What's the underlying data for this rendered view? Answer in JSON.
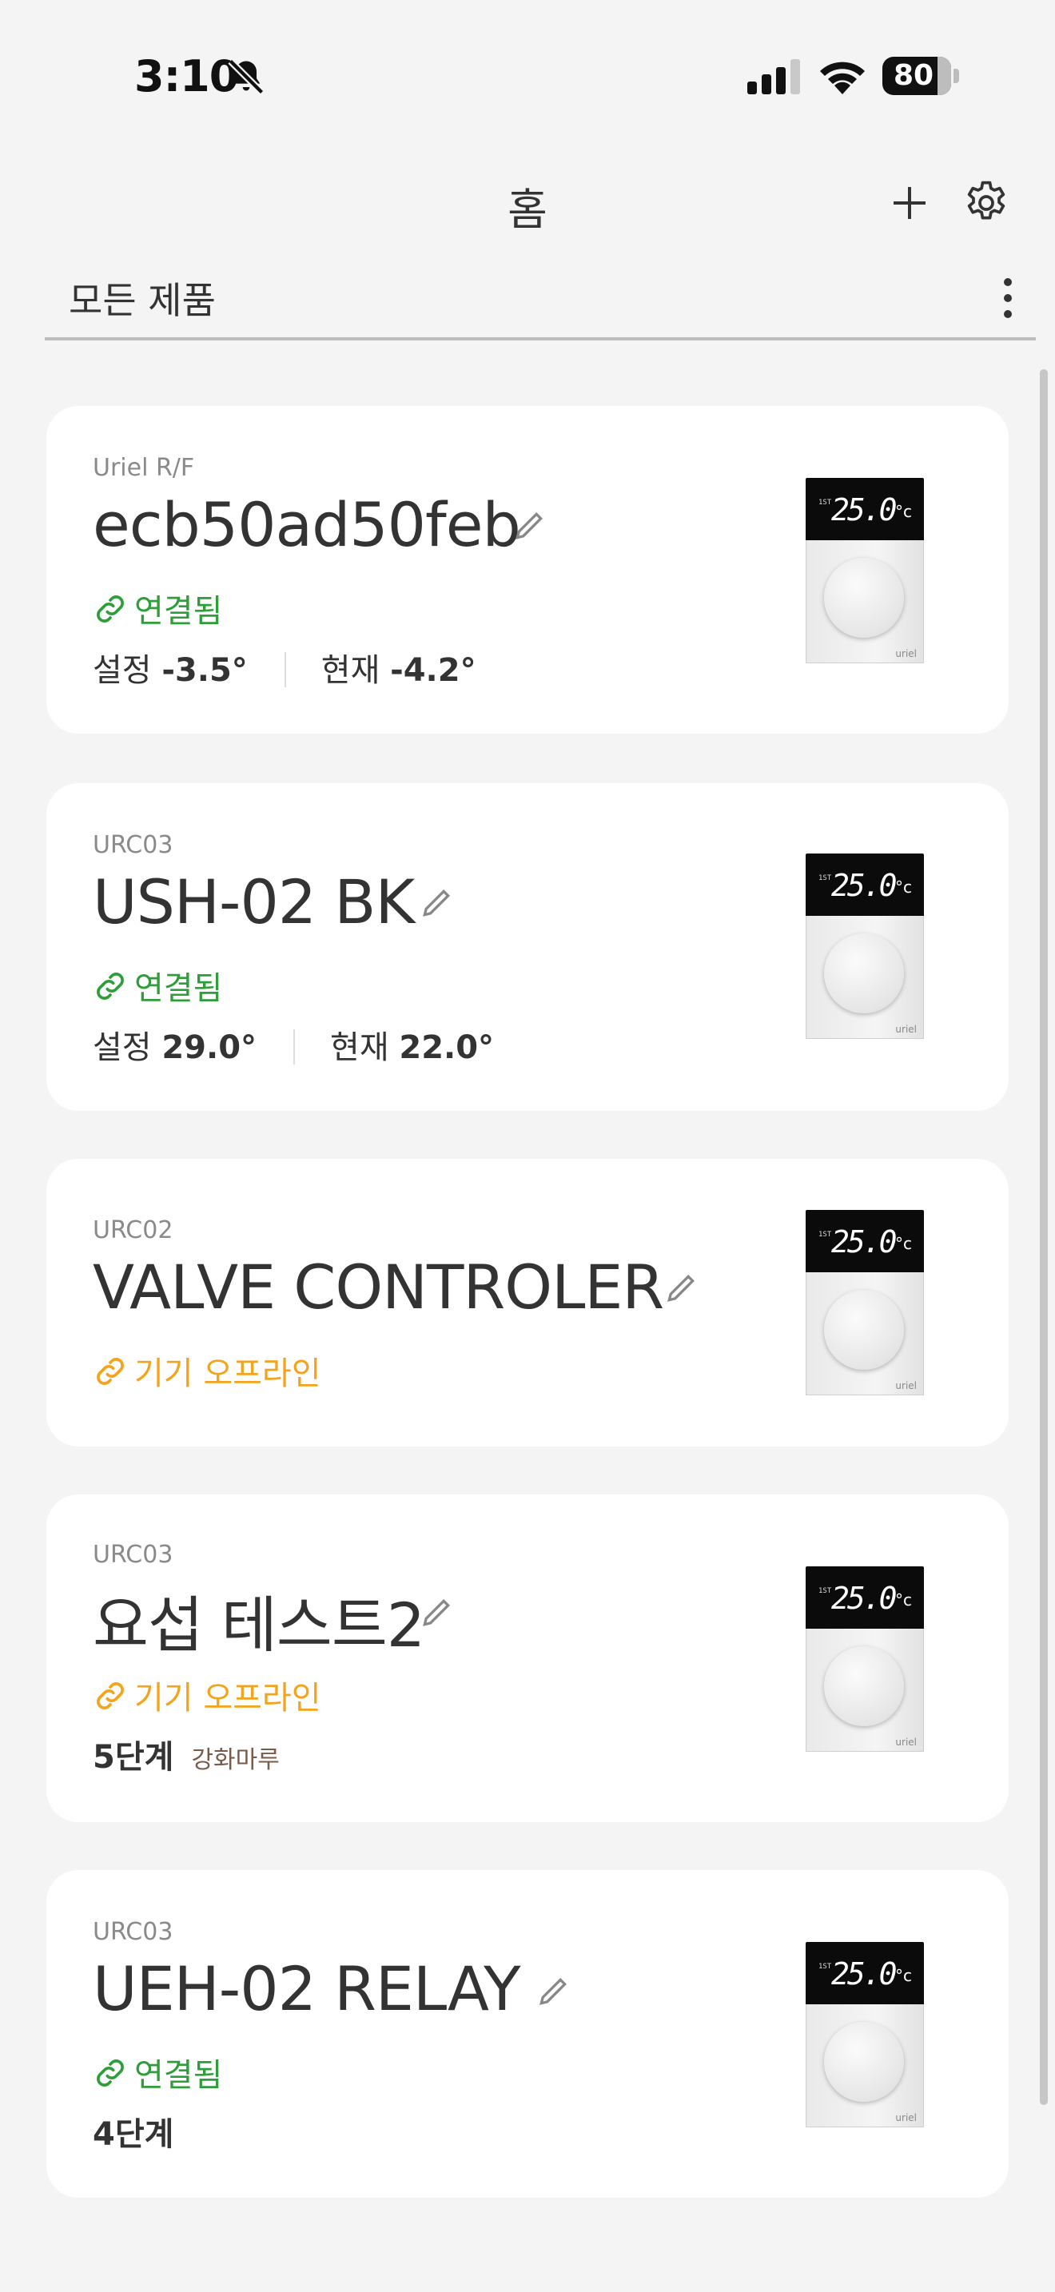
{
  "status_bar": {
    "time": "3:10",
    "battery": "80"
  },
  "header": {
    "title": "홈"
  },
  "filter": {
    "label": "모든 제품"
  },
  "device_display": {
    "temp": "25.0",
    "unit": "°c",
    "small": "1ST",
    "brand": "uriel"
  },
  "devices": [
    {
      "model": "Uriel R/F",
      "name": "ecb50ad50feb",
      "status": "연결됨",
      "set_label": "설정",
      "set_value": "-3.5°",
      "current_label": "현재",
      "current_value": "-4.2°"
    },
    {
      "model": "URC03",
      "name": "USH-02 BK",
      "status": "연결됨",
      "set_label": "설정",
      "set_value": "29.0°",
      "current_label": "현재",
      "current_value": "22.0°"
    },
    {
      "model": "URC02",
      "name": "VALVE CONTROLER",
      "status": "기기 오프라인"
    },
    {
      "model": "URC03",
      "name": "요섭 테스트2",
      "status": "기기 오프라인",
      "level": "5단계",
      "floor": "강화마루"
    },
    {
      "model": "URC03",
      "name": "UEH-02 RELAY",
      "status": "연결됨",
      "level": "4단계"
    }
  ],
  "colors": {
    "connected": "#2e9d3a",
    "offline": "#f4a41c",
    "background": "#f4f4f4",
    "card": "#ffffff"
  },
  "icons": {
    "add": "plus-icon",
    "settings": "gear-icon",
    "more": "more-vertical-icon",
    "edit": "pencil-icon",
    "link": "link-icon",
    "mute": "bell-slash-icon"
  }
}
